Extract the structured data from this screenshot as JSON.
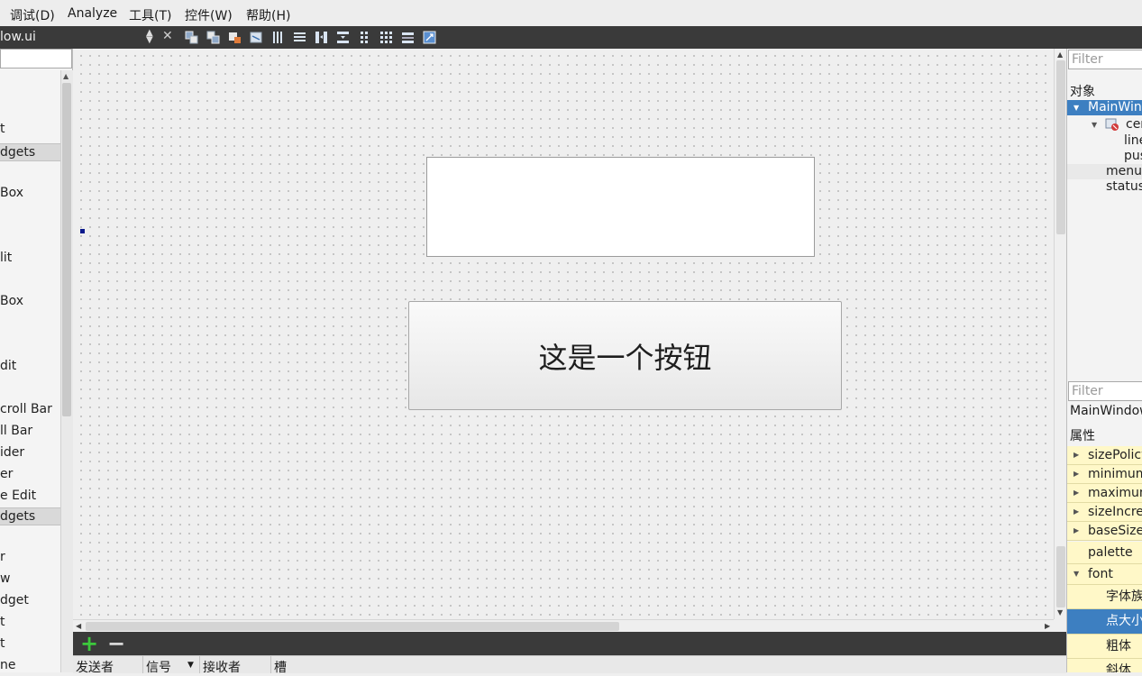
{
  "menubar": {
    "items": [
      "调试(D)",
      "Analyze",
      "工具(T)",
      "控件(W)",
      "帮助(H)"
    ]
  },
  "toolbar": {
    "file_name": "low.ui",
    "icons": [
      "send-to-back-icon",
      "bring-to-front-icon",
      "edit-widgets-icon",
      "edit-signals-slots-icon",
      "layout-horizontal-icon",
      "layout-vertical-icon",
      "layout-horizontal-splitter-icon",
      "layout-vertical-splitter-icon",
      "layout-form-icon",
      "layout-grid-icon",
      "break-layout-icon",
      "adjust-size-icon"
    ]
  },
  "widget_box": {
    "filter_value": "",
    "items": [
      {
        "label": "t",
        "kind": "item"
      },
      {
        "label": "dgets",
        "kind": "category"
      },
      {
        "label": "Box",
        "kind": "item"
      },
      {
        "label": "lit",
        "kind": "item"
      },
      {
        "label": "Box",
        "kind": "item"
      },
      {
        "label": "dit",
        "kind": "item"
      },
      {
        "label": "croll Bar",
        "kind": "item"
      },
      {
        "label": "ll Bar",
        "kind": "item"
      },
      {
        "label": "ider",
        "kind": "item"
      },
      {
        "label": "er",
        "kind": "item"
      },
      {
        "label": "e Edit",
        "kind": "item"
      },
      {
        "label": "dgets",
        "kind": "category"
      },
      {
        "label": "r",
        "kind": "item"
      },
      {
        "label": "w",
        "kind": "item"
      },
      {
        "label": "dget",
        "kind": "item"
      },
      {
        "label": "t",
        "kind": "item"
      },
      {
        "label": "t",
        "kind": "item"
      },
      {
        "label": "ne",
        "kind": "item"
      }
    ]
  },
  "form": {
    "push_button_text": "这是一个按钮",
    "line_edit_value": ""
  },
  "signal_slot_editor": {
    "columns": [
      "发送者",
      "信号",
      "接收者",
      "槽"
    ]
  },
  "object_inspector": {
    "filter_placeholder": "Filter",
    "header": "对象",
    "rows": [
      "MainWin",
      "cer",
      "line",
      "pus",
      "menul",
      "status"
    ]
  },
  "property_editor": {
    "filter_placeholder": "Filter",
    "object_name": "MainWindow",
    "header": "属性",
    "rows": [
      "sizePolicy",
      "minimum",
      "maximum",
      "sizeIncre",
      "baseSize",
      "palette",
      "font",
      "字体族",
      "点大小",
      "粗体",
      "斜体"
    ]
  },
  "colors": {
    "selection": "#3d7fc1",
    "property_row": "#fff8c8",
    "toolbar_dark": "#3a3a3a",
    "add_green": "#3cc83c"
  }
}
